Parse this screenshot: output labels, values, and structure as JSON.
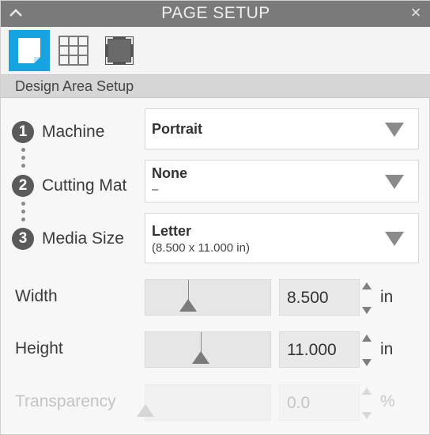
{
  "window": {
    "title": "PAGE SETUP",
    "collapse_icon": "chevron-up-icon",
    "close_icon": "close-icon",
    "close_glyph": "×"
  },
  "toolbar": {
    "buttons": [
      {
        "icon": "page-icon",
        "active": true
      },
      {
        "icon": "grid-icon",
        "active": false
      },
      {
        "icon": "bleed-icon",
        "active": false
      }
    ],
    "active_color": "#16a4e0"
  },
  "section": {
    "title": "Design Area Setup"
  },
  "steps": [
    {
      "number": "1",
      "label": "Machine",
      "value": "Portrait",
      "sub": ""
    },
    {
      "number": "2",
      "label": "Cutting Mat",
      "value": "None",
      "sub": "–"
    },
    {
      "number": "3",
      "label": "Media Size",
      "value": "Letter",
      "sub": "(8.500 x 11.000 in)"
    }
  ],
  "dimensions": [
    {
      "label": "Width",
      "value": "8.500",
      "unit": "in",
      "slider_fraction": 0.34,
      "disabled": false
    },
    {
      "label": "Height",
      "value": "11.000",
      "unit": "in",
      "slider_fraction": 0.44,
      "disabled": false
    },
    {
      "label": "Transparency",
      "value": "0.0",
      "unit": "%",
      "slider_fraction": 0.0,
      "disabled": true
    }
  ]
}
